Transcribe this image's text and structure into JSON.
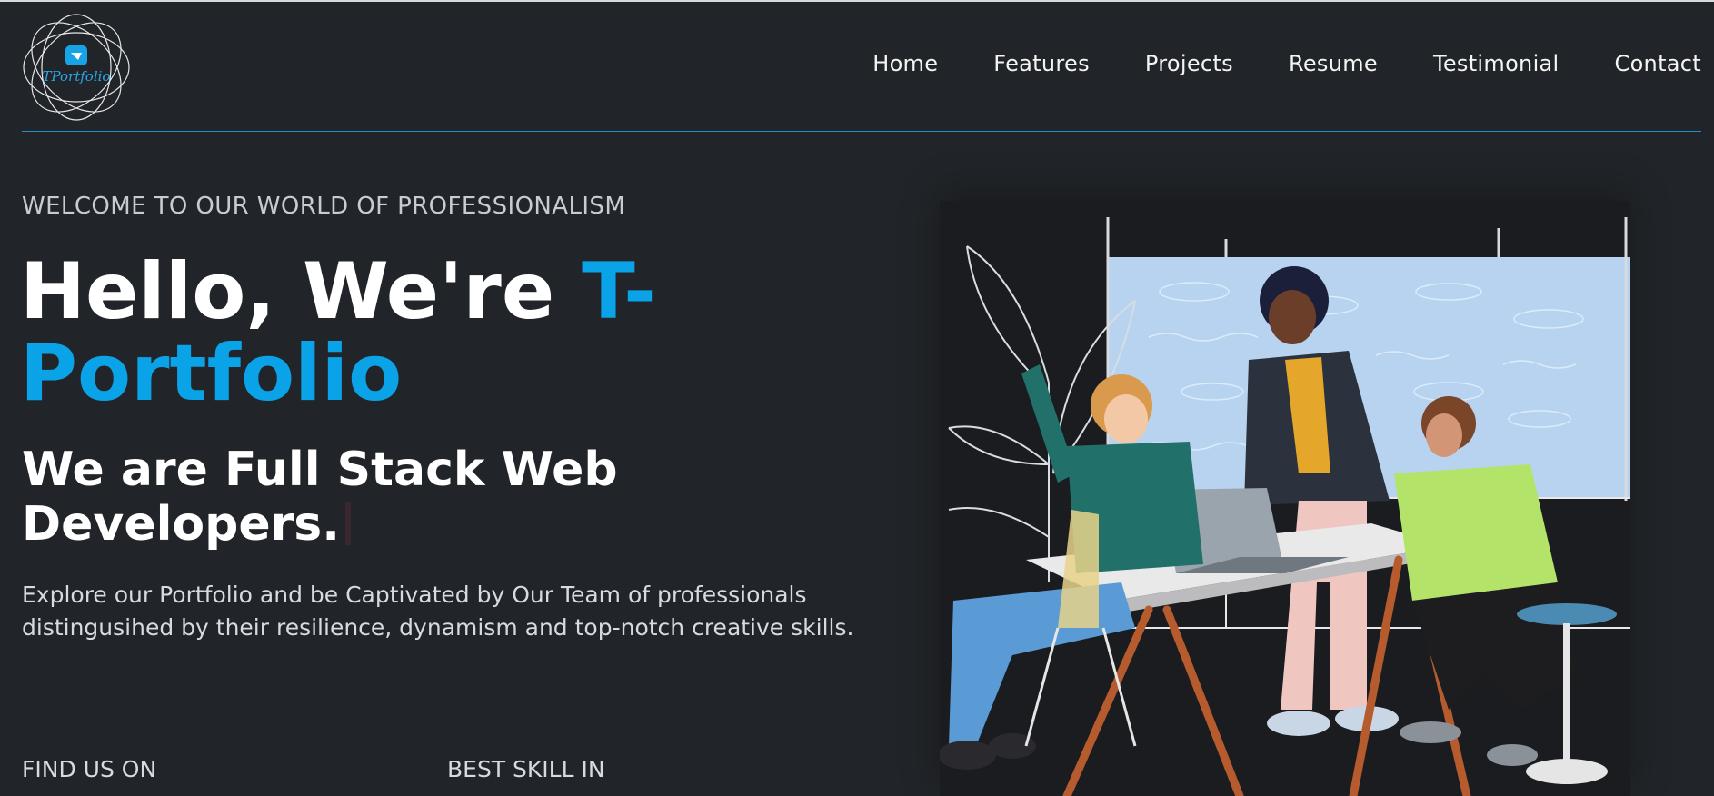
{
  "header": {
    "logo_text": "TPortfolio",
    "nav": [
      "Home",
      "Features",
      "Projects",
      "Resume",
      "Testimonial",
      "Contact"
    ]
  },
  "hero": {
    "kicker": "WELCOME TO OUR WORLD OF PROFESSIONALISM",
    "headline_prefix": "Hello, We're ",
    "headline_accent": "T-Portfolio",
    "subhead": "We are Full Stack Web Developers.",
    "paragraph": "Explore our Portfolio and be Captivated by Our Team of professionals distingusihed by their resilience, dynamism and top-notch creative skills.",
    "find_us_label": "FIND US ON",
    "best_skill_label": "BEST SKILL IN"
  },
  "colors": {
    "background": "#212428",
    "accent": "#0ba3e8",
    "text": "#ffffff"
  },
  "icons": [
    "logo-icon",
    "team-illustration"
  ]
}
